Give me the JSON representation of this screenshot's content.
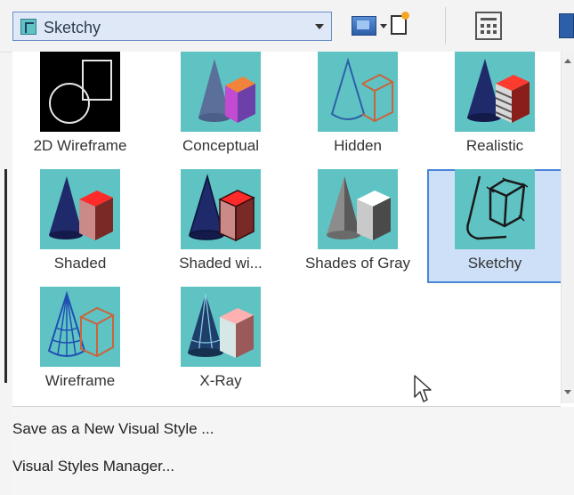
{
  "toolbar": {
    "style_dropdown": {
      "value": "Sketchy"
    }
  },
  "gallery": {
    "items": [
      {
        "label": "2D Wireframe",
        "icon": "2d-wireframe-icon"
      },
      {
        "label": "Conceptual",
        "icon": "conceptual-icon"
      },
      {
        "label": "Hidden",
        "icon": "hidden-icon"
      },
      {
        "label": "Realistic",
        "icon": "realistic-icon"
      },
      {
        "label": "Shaded",
        "icon": "shaded-icon"
      },
      {
        "label": "Shaded wi...",
        "icon": "shaded-with-edges-icon"
      },
      {
        "label": "Shades of Gray",
        "icon": "shades-of-gray-icon"
      },
      {
        "label": "Sketchy",
        "icon": "sketchy-icon",
        "selected": true
      },
      {
        "label": "Wireframe",
        "icon": "wireframe-icon"
      },
      {
        "label": "X-Ray",
        "icon": "x-ray-icon"
      }
    ]
  },
  "menu": {
    "save_new_style": "Save as a New Visual Style ...",
    "styles_manager": "Visual Styles Manager..."
  },
  "colors": {
    "thumb_bg": "#5fc3c4",
    "selection_bg": "#cde0f7",
    "selection_border": "#4a86d6",
    "cube_red": "#e5322a",
    "cone_navy": "#1f2a6b"
  }
}
